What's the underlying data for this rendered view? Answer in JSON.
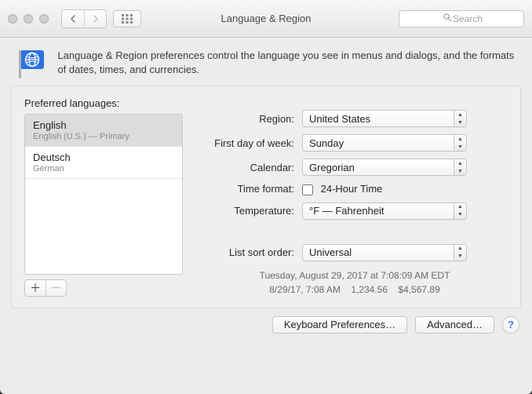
{
  "window": {
    "title": "Language & Region",
    "search_placeholder": "Search"
  },
  "description": "Language & Region preferences control the language you see in menus and dialogs, and the formats of dates, times, and currencies.",
  "preferred_languages": {
    "label": "Preferred languages:",
    "items": [
      {
        "name": "English",
        "sub": "English (U.S.) — Primary",
        "selected": true
      },
      {
        "name": "Deutsch",
        "sub": "German",
        "selected": false
      }
    ]
  },
  "form": {
    "region": {
      "label": "Region:",
      "value": "United States"
    },
    "first_day": {
      "label": "First day of week:",
      "value": "Sunday"
    },
    "calendar": {
      "label": "Calendar:",
      "value": "Gregorian"
    },
    "time_format": {
      "label": "Time format:",
      "checkbox_label": "24-Hour Time",
      "checked": false
    },
    "temperature": {
      "label": "Temperature:",
      "value": "°F — Fahrenheit"
    },
    "list_sort": {
      "label": "List sort order:",
      "value": "Universal"
    }
  },
  "examples": {
    "line1": "Tuesday, August 29, 2017 at 7:08:09 AM EDT",
    "line2": "8/29/17, 7:08 AM    1,234.56    $4,567.89"
  },
  "buttons": {
    "keyboard_prefs": "Keyboard Preferences…",
    "advanced": "Advanced…"
  }
}
